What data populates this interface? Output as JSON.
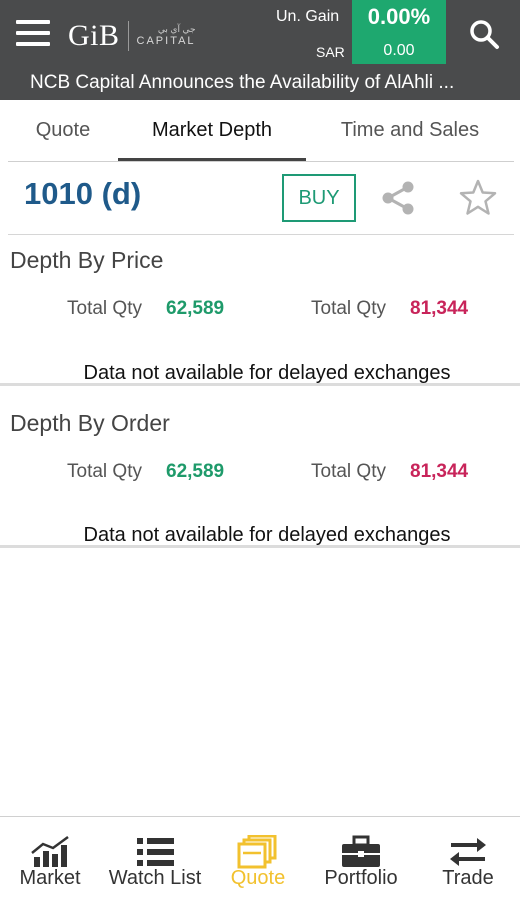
{
  "header": {
    "logo_main": "GiB",
    "logo_arabic": "جي آي بي",
    "logo_capital": "CAPITAL",
    "ungain_label": "Un. Gain",
    "gain_percent": "0.00%",
    "sar_label": "SAR",
    "gain_value": "0.00",
    "ticker_text": "NCB Capital Announces the Availability of AlAhli ..."
  },
  "tabs": [
    {
      "label": "Quote",
      "active": false
    },
    {
      "label": "Market Depth",
      "active": true
    },
    {
      "label": "Time and Sales",
      "active": false
    }
  ],
  "symbol": {
    "name": "1010 (d)",
    "buy_label": "BUY"
  },
  "depth_by_price": {
    "title": "Depth By Price",
    "bid_label": "Total Qty",
    "bid_qty": "62,589",
    "ask_label": "Total Qty",
    "ask_qty": "81,344",
    "message": "Data not available for delayed exchanges"
  },
  "depth_by_order": {
    "title": "Depth By Order",
    "bid_label": "Total Qty",
    "bid_qty": "62,589",
    "ask_label": "Total Qty",
    "ask_qty": "81,344",
    "message": "Data not available for delayed exchanges"
  },
  "bottom_nav": [
    {
      "label": "Market",
      "icon": "chart-bars-icon",
      "active": false
    },
    {
      "label": "Watch List",
      "icon": "list-icon",
      "active": false
    },
    {
      "label": "Quote",
      "icon": "quote-windows-icon",
      "active": true
    },
    {
      "label": "Portfolio",
      "icon": "briefcase-icon",
      "active": false
    },
    {
      "label": "Trade",
      "icon": "swap-arrows-icon",
      "active": false
    }
  ],
  "colors": {
    "header_bg": "#4a4b4c",
    "gain_bg": "#1ea86f",
    "symbol_blue": "#1f5a8a",
    "buy_green": "#1e9a75",
    "qty_green": "#1e9a6a",
    "qty_red": "#c8245a",
    "nav_active": "#f2c12e"
  }
}
